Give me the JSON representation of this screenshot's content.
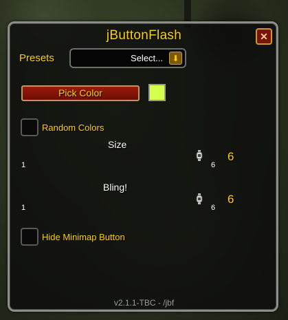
{
  "window": {
    "title": "jButtonFlash",
    "close_glyph": "✕",
    "version": "v2.1.1-TBC - /jbf"
  },
  "presets": {
    "label": "Presets",
    "selected": "Select...",
    "arrow_icon": "chevron-down-icon"
  },
  "color": {
    "button_label": "Pick Color",
    "swatch_hex": "#d4ff4c"
  },
  "options": {
    "random_colors": {
      "label": "Random Colors",
      "checked": false
    },
    "hide_minimap": {
      "label": "Hide Minimap Button",
      "checked": false
    }
  },
  "sliders": [
    {
      "label": "Size",
      "min_label": "1",
      "max_label": "6",
      "value": "6"
    },
    {
      "label": "Bling!",
      "min_label": "1",
      "max_label": "6",
      "value": "6"
    }
  ]
}
